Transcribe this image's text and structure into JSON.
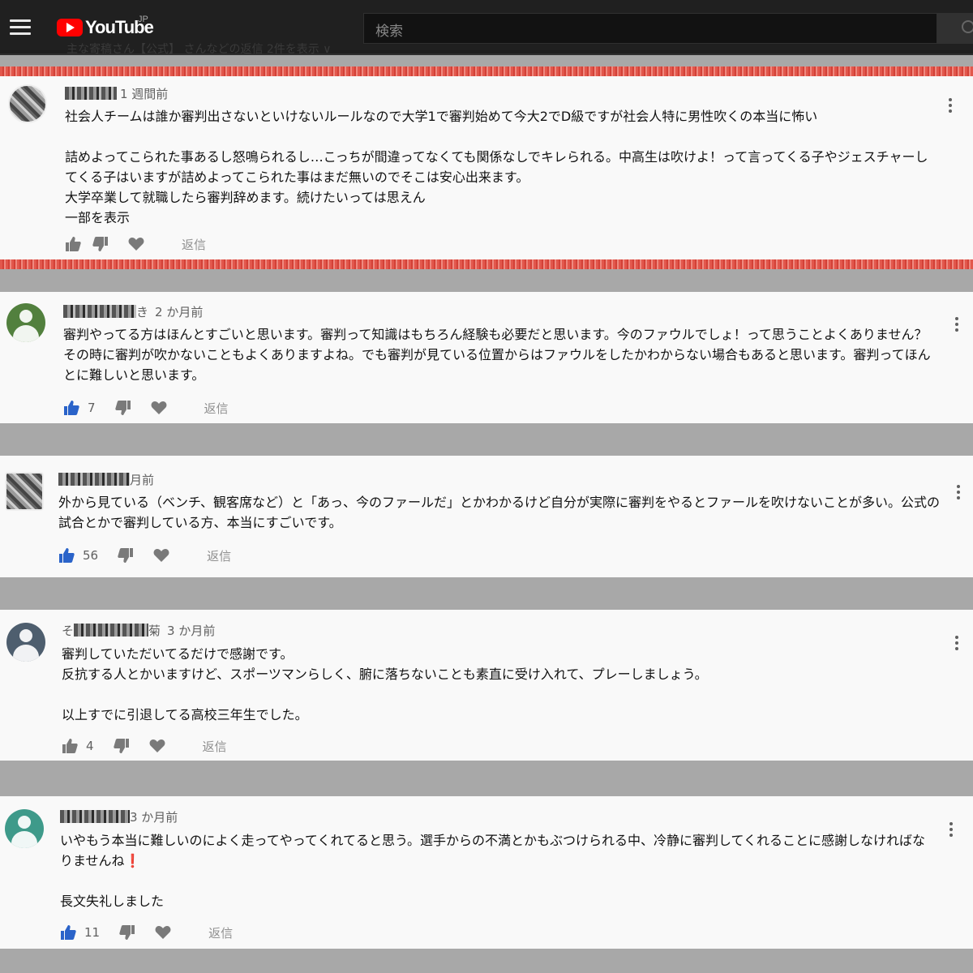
{
  "header": {
    "logo_text": "YouTube",
    "region": "JP",
    "search_placeholder": "検索",
    "ghost_text": "主な寄稿さん【公式】 さんなどの返信 2件を表示 ∨"
  },
  "colors": {
    "like_active": "#2a63c9",
    "icon_gray": "#7a7a7a",
    "brand_red": "#ff0000"
  },
  "comments": [
    {
      "time": "1 週間前",
      "body": "社会人チームは誰か審判出さないといけないルールなので大学1で審判始めて今大2でD級ですが社会人特に男性吹くの本当に怖い\n\n詰めよってこられた事あるし怒鳴られるし…こっちが間違ってなくても関係なしでキレられる。中高生は吹けよ！って言ってくる子やジェスチャーしてくる子はいますが詰めよってこられた事はまだ無いのでそこは安心出来ます。\n大学卒業して就職したら審判辞めます。続けたいっては思えん",
      "more": "一部を表示",
      "likes": "",
      "reply": "返信"
    },
    {
      "time": "2 か月前",
      "name_tail": "き",
      "body": "審判やってる方はほんとすごいと思います。審判って知識はもちろん経験も必要だと思います。今のファウルでしょ！って思うことよくありません？その時に審判が吹かないこともよくありますよね。でも審判が見ている位置からはファウルをしたかわからない場合もあると思います。審判ってほんとに難しいと思います。",
      "likes": "7",
      "reply": "返信"
    },
    {
      "time": "月前",
      "body": "外から見ている（ベンチ、観客席など）と「あっ、今のファールだ」とかわかるけど自分が実際に審判をやるとファールを吹けないことが多い。公式の試合とかで審判している方、本当にすごいです。",
      "likes": "56",
      "reply": "返信"
    },
    {
      "time": "3 か月前",
      "name_head": "そ",
      "name_tail": "菊",
      "body": "審判していただいてるだけで感謝です。\n反抗する人とかいますけど、スポーツマンらしく、腑に落ちないことも素直に受け入れて、プレーしましょう。\n\n以上すでに引退してる高校三年生でした。",
      "likes": "4",
      "reply": "返信"
    },
    {
      "time": "3 か月前",
      "body": "いやもう本当に難しいのによく走ってやってくれてると思う。選手からの不満とかもぶつけられる中、冷静に審判してくれることに感謝しなければなりませんね",
      "exclaim": "❗",
      "body2": "\n\n長文失礼しました",
      "likes": "11",
      "reply": "返信"
    }
  ]
}
